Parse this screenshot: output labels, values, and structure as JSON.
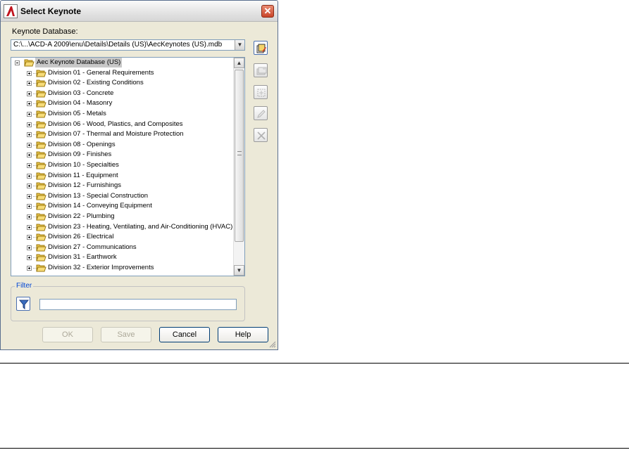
{
  "dialog": {
    "title": "Select Keynote",
    "close_label": "✕",
    "database_label": "Keynote Database:",
    "database_value": "C:\\...\\ACD-A 2009\\enu\\Details\\Details (US)\\AecKeynotes (US).mdb",
    "combo_arrow": "▼"
  },
  "tree": {
    "root": "Aec Keynote Database (US)",
    "items": [
      "Division 01 - General Requirements",
      "Division 02 - Existing Conditions",
      "Division 03 - Concrete",
      "Division 04 - Masonry",
      "Division 05 - Metals",
      "Division 06 - Wood, Plastics, and Composites",
      "Division 07 - Thermal and Moisture Protection",
      "Division 08 - Openings",
      "Division 09 - Finishes",
      "Division 10 - Specialties",
      "Division 11 - Equipment",
      "Division 12 - Furnishings",
      "Division 13 - Special Construction",
      "Division 14 - Conveying Equipment",
      "Division 22 - Plumbing",
      "Division 23 - Heating, Ventilating, and Air-Conditioning (HVAC)",
      "Division 26 - Electrical",
      "Division 27 - Communications",
      "Division 31 - Earthwork",
      "Division 32 - Exterior Improvements"
    ],
    "scroll_up": "▲",
    "scroll_down": "▼"
  },
  "filter": {
    "legend": "Filter",
    "value": ""
  },
  "buttons": {
    "ok": "OK",
    "save": "Save",
    "cancel": "Cancel",
    "help": "Help"
  },
  "icons": {
    "side_buttons": [
      "browse-database-icon",
      "add-group-icon",
      "add-keynote-icon",
      "edit-keynote-icon",
      "delete-icon"
    ],
    "filter": "funnel-filter-icon",
    "folder": "folder-icon"
  },
  "colors": {
    "dialog_bg": "#ece9d8",
    "selection": "#c8c8c8",
    "accent": "#0046d5",
    "close": "#c9452a"
  }
}
